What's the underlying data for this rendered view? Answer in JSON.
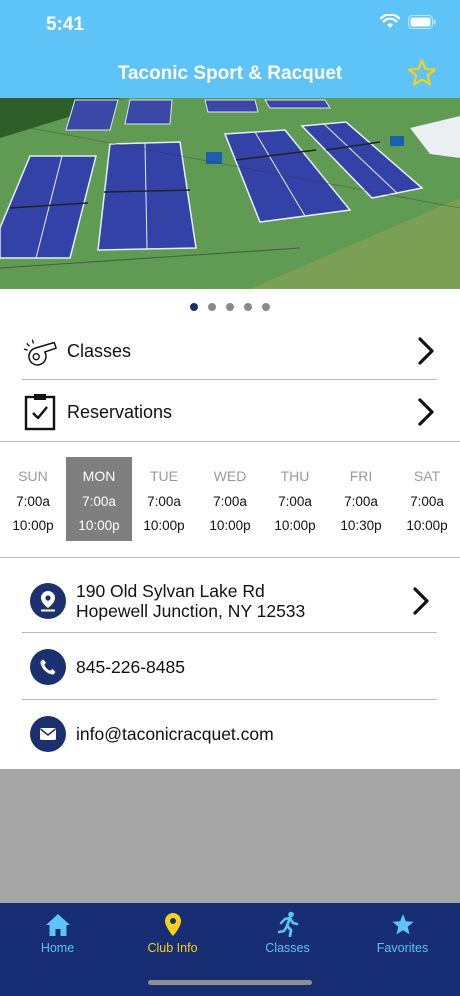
{
  "status_bar": {
    "time": "5:41"
  },
  "header": {
    "title": "Taconic Sport & Racquet"
  },
  "carousel": {
    "page_count": 5,
    "active_index": 0
  },
  "menu": [
    {
      "label": "Classes",
      "icon": "whistle-icon"
    },
    {
      "label": "Reservations",
      "icon": "clipboard-check-icon"
    }
  ],
  "hours": [
    {
      "day": "SUN",
      "open": "7:00a",
      "close": "10:00p"
    },
    {
      "day": "MON",
      "open": "7:00a",
      "close": "10:00p"
    },
    {
      "day": "TUE",
      "open": "7:00a",
      "close": "10:00p"
    },
    {
      "day": "WED",
      "open": "7:00a",
      "close": "10:00p"
    },
    {
      "day": "THU",
      "open": "7:00a",
      "close": "10:00p"
    },
    {
      "day": "FRI",
      "open": "7:00a",
      "close": "10:30p"
    },
    {
      "day": "SAT",
      "open": "7:00a",
      "close": "10:00p"
    }
  ],
  "hours_active_day": "MON",
  "contact": {
    "address_line1": "190 Old Sylvan Lake Rd",
    "address_line2": "Hopewell Junction, NY 12533",
    "phone": "845-226-8485",
    "email": "info@taconicracquet.com"
  },
  "tabs": [
    {
      "label": "Home",
      "icon": "home-icon"
    },
    {
      "label": "Club Info",
      "icon": "location-pin-icon"
    },
    {
      "label": "Classes",
      "icon": "runner-icon"
    },
    {
      "label": "Favorites",
      "icon": "star-icon"
    }
  ],
  "active_tab": "Club Info",
  "colors": {
    "header_bg": "#5ec3f6",
    "navy": "#1c2f6e",
    "tabbar_bg": "#172e74",
    "accent_yellow": "#f5d21a",
    "tab_inactive": "#5ec3f6",
    "active_day_bg": "#7f7f7f"
  }
}
